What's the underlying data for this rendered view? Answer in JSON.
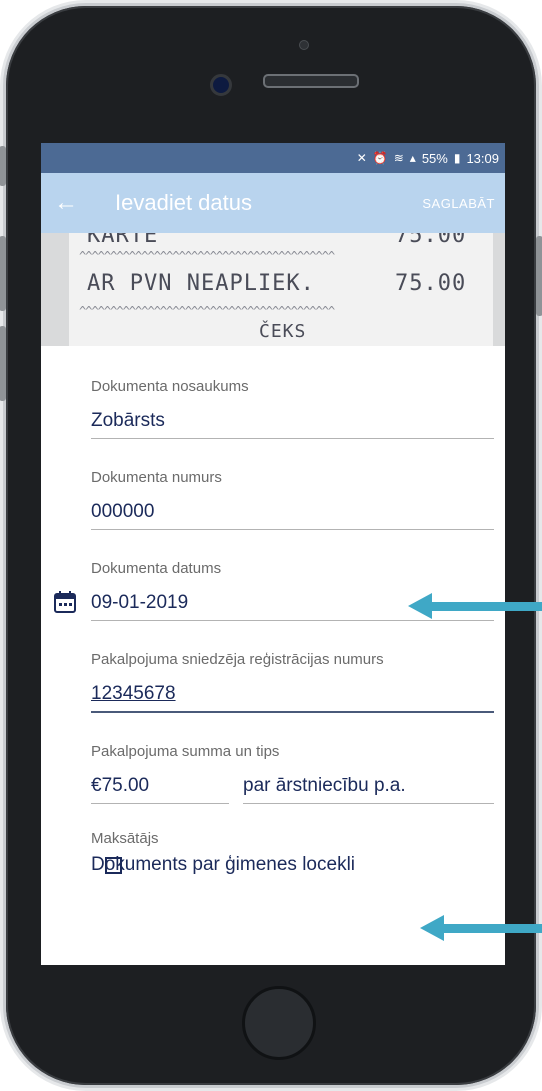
{
  "statusbar": {
    "battery": "55%",
    "time": "13:09"
  },
  "appbar": {
    "back": "←",
    "title": "Ievadiet datus",
    "save": "SAGLABĀT"
  },
  "receipt": {
    "line1_left": "KARTE",
    "line1_right": "75.00",
    "line2_left": "AR PVN NEAPLIEK.",
    "line2_right": "75.00",
    "line3": "ČEKS"
  },
  "form": {
    "doc_name_label": "Dokumenta nosaukums",
    "doc_name_value": "Zobārsts",
    "doc_number_label": "Dokumenta numurs",
    "doc_number_value": "000000",
    "doc_date_label": "Dokumenta datums",
    "doc_date_value": "09-01-2019",
    "provider_label": "Pakalpojuma sniedzēja reģistrācijas numurs",
    "provider_value": "12345678",
    "amount_label": "Pakalpojuma summa un tips",
    "amount_value": "€75.00",
    "type_value": "par ārstniecību p.a.",
    "payer_label": "Maksātājs",
    "family_checkbox_label": "Dokuments par ģimenes locekli"
  },
  "icons": {
    "calendar": "calendar-icon",
    "back": "arrow-back-icon"
  },
  "colors": {
    "appbar": "#b9d4ee",
    "statusbar": "#4c6a94",
    "text": "#1b2a5a",
    "annotation_arrow": "#3fa8c6"
  }
}
